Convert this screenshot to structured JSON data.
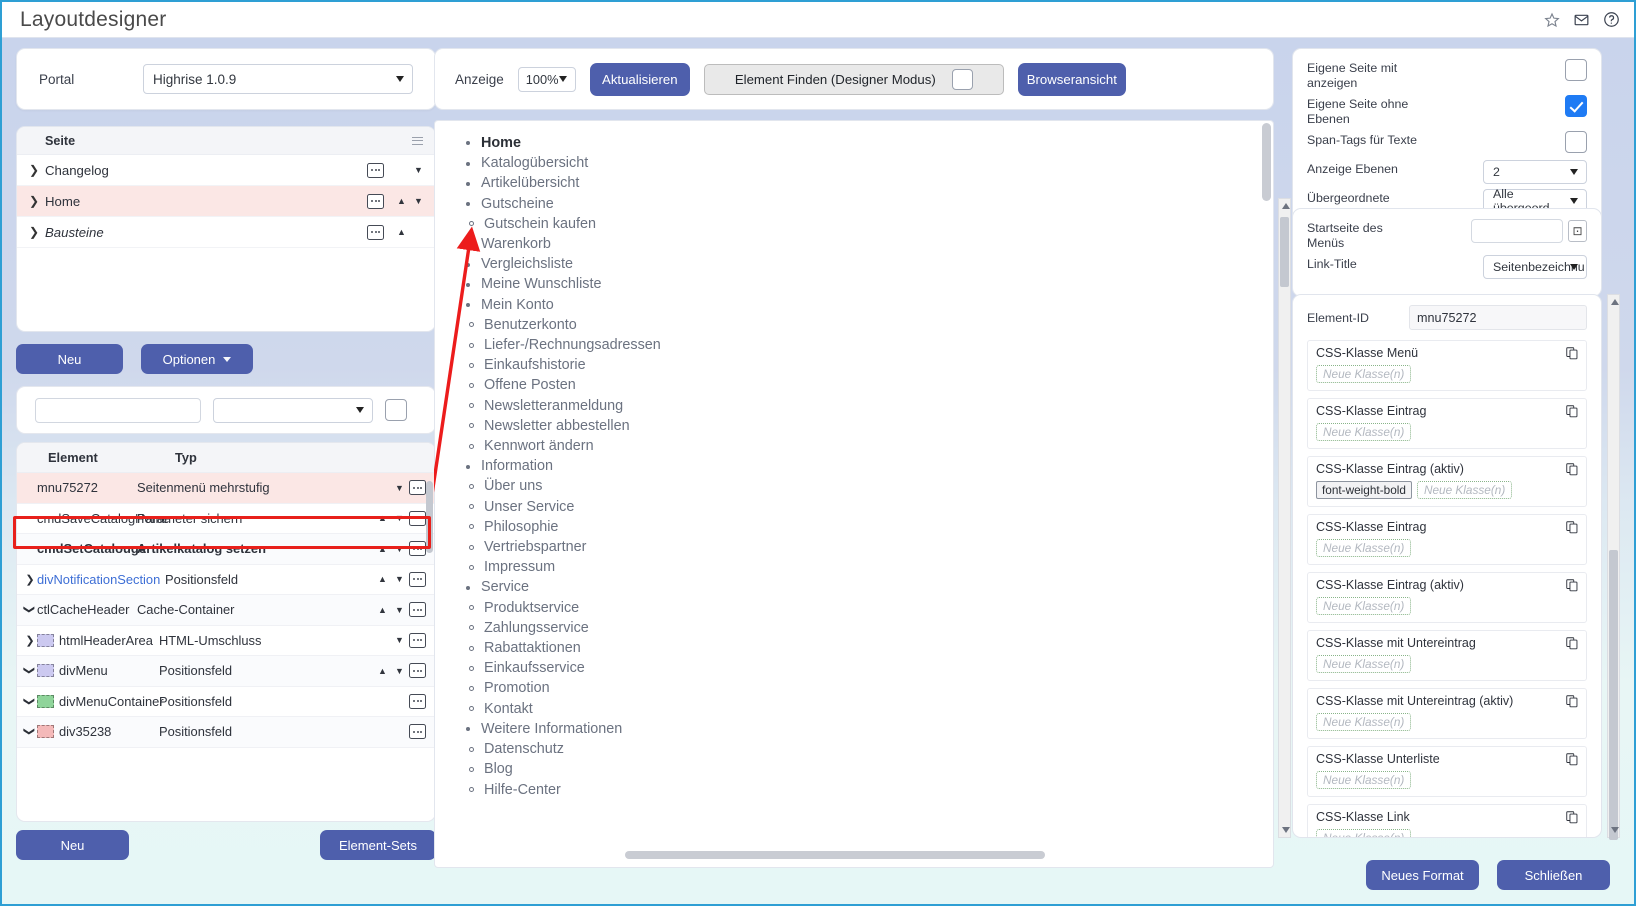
{
  "window": {
    "title": "Layoutdesigner",
    "header_icons": [
      "star-icon",
      "mail-icon",
      "help-icon"
    ]
  },
  "colors": {
    "accent": "#4e5fac",
    "selection_row": "#fbe7e5",
    "highlight_outline": "#e8201b",
    "checkbox_on": "#1f7bf4",
    "window_border": "#2e9fd4"
  },
  "left": {
    "portal_label": "Portal",
    "portal_value": "Highrise 1.0.9",
    "page_table": {
      "header": "Seite",
      "rows": [
        {
          "name": "Changelog",
          "italic": false,
          "selected": false,
          "up": false,
          "down": true
        },
        {
          "name": "Home",
          "italic": false,
          "selected": true,
          "up": true,
          "down": true
        },
        {
          "name": "Bausteine",
          "italic": true,
          "selected": false,
          "up": true,
          "down": false
        }
      ]
    },
    "buttons_top": {
      "new": "Neu",
      "options": "Optionen"
    },
    "filter": {
      "text_value": "",
      "select_value": ""
    },
    "element_table": {
      "columns": [
        "Element",
        "Typ"
      ],
      "rows": [
        {
          "name": "mnu75272",
          "type": "Seitenmenü mehrstufig",
          "selected": true,
          "bold": false,
          "link": false,
          "twisty": "",
          "swatch": "",
          "up": false,
          "down": true
        },
        {
          "name": "cmdSaveCatalogHome",
          "type": "Parameter sichern",
          "selected": false,
          "bold": false,
          "link": false,
          "twisty": "",
          "swatch": "",
          "up": true,
          "down": true
        },
        {
          "name": "cmdSetCatalouge",
          "type": "Artikelkatalog setzen",
          "selected": false,
          "bold": true,
          "link": false,
          "twisty": "",
          "swatch": "",
          "up": true,
          "down": true
        },
        {
          "name": "divNotificationSection",
          "type": "Positionsfeld",
          "selected": false,
          "bold": false,
          "link": true,
          "twisty": "right",
          "swatch": "",
          "up": true,
          "down": true
        },
        {
          "name": "ctlCacheHeader",
          "type": "Cache-Container",
          "selected": false,
          "bold": false,
          "link": false,
          "twisty": "down",
          "swatch": "",
          "up": true,
          "down": true
        },
        {
          "name": "htmlHeaderArea",
          "type": "HTML-Umschluss",
          "selected": false,
          "bold": false,
          "link": false,
          "twisty": "right",
          "swatch": "#ccc9f0",
          "up": false,
          "down": true
        },
        {
          "name": "divMenu",
          "type": "Positionsfeld",
          "selected": false,
          "bold": false,
          "link": false,
          "twisty": "down",
          "swatch": "#ccc9f0",
          "up": true,
          "down": true
        },
        {
          "name": "divMenuContainer",
          "type": "Positionsfeld",
          "selected": false,
          "bold": false,
          "link": false,
          "twisty": "down",
          "swatch": "#8fd49a",
          "up": false,
          "down": false
        },
        {
          "name": "div35238",
          "type": "Positionsfeld",
          "selected": false,
          "bold": false,
          "link": false,
          "twisty": "down",
          "swatch": "#f4b9b9",
          "up": false,
          "down": false
        }
      ]
    },
    "buttons_bottom": {
      "new": "Neu",
      "element_sets": "Element-Sets"
    }
  },
  "center": {
    "toolbar": {
      "anzeige_label": "Anzeige",
      "zoom_value": "100%",
      "refresh_label": "Aktualisieren",
      "find_label": "Element Finden (Designer Modus)",
      "find_checked": false,
      "browser_label": "Browseransicht"
    },
    "menu_preview": [
      {
        "label": "Home",
        "bold": true,
        "children": []
      },
      {
        "label": "Katalogübersicht",
        "bold": false,
        "children": []
      },
      {
        "label": "Artikelübersicht",
        "bold": false,
        "children": []
      },
      {
        "label": "Gutscheine",
        "bold": false,
        "children": [
          "Gutschein kaufen"
        ]
      },
      {
        "label": "Warenkorb",
        "bold": false,
        "children": []
      },
      {
        "label": "Vergleichsliste",
        "bold": false,
        "children": []
      },
      {
        "label": "Meine Wunschliste",
        "bold": false,
        "children": []
      },
      {
        "label": "Mein Konto",
        "bold": false,
        "children": [
          "Benutzerkonto",
          "Liefer-/Rechnungsadressen",
          "Einkaufshistorie",
          "Offene Posten",
          "Newsletteranmeldung",
          "Newsletter abbestellen",
          "Kennwort ändern"
        ]
      },
      {
        "label": "Information",
        "bold": false,
        "children": [
          "Über uns",
          "Unser Service",
          "Philosophie",
          "Vertriebspartner",
          "Impressum"
        ]
      },
      {
        "label": "Service",
        "bold": false,
        "children": [
          "Produktservice",
          "Zahlungsservice",
          "Rabattaktionen",
          "Einkaufsservice",
          "Promotion",
          "Kontakt"
        ]
      },
      {
        "label": "Weitere Informationen",
        "bold": false,
        "children": [
          "Datenschutz",
          "Blog",
          "Hilfe-Center"
        ]
      }
    ]
  },
  "right": {
    "options": [
      {
        "label": "Eigene Seite mit anzeigen",
        "checked": false
      },
      {
        "label": "Eigene Seite ohne Ebenen",
        "checked": true
      },
      {
        "label": "Span-Tags für Texte",
        "checked": false
      }
    ],
    "ebenen_label": "Anzeige Ebenen",
    "ebenen_value": "2",
    "uebergeordnet_label": "Übergeordnete Seite(n) als aktiv anzeigen",
    "uebergeordnet_value": "Alle übergeord",
    "startseite_label": "Startseite des Menüs",
    "startseite_value": "",
    "linktitle_label": "Link-Title",
    "linktitle_value": "Seitenbezeichnu",
    "element_id_label": "Element-ID",
    "element_id_value": "mnu75272",
    "css_blocks": [
      {
        "title": "CSS-Klasse Menü",
        "values": [],
        "placeholder": "Neue Klasse(n)"
      },
      {
        "title": "CSS-Klasse Eintrag",
        "values": [],
        "placeholder": "Neue Klasse(n)"
      },
      {
        "title": "CSS-Klasse Eintrag (aktiv)",
        "values": [
          "font-weight-bold"
        ],
        "placeholder": "Neue Klasse(n)"
      },
      {
        "title": "CSS-Klasse Eintrag",
        "values": [],
        "placeholder": "Neue Klasse(n)"
      },
      {
        "title": "CSS-Klasse Eintrag (aktiv)",
        "values": [],
        "placeholder": "Neue Klasse(n)"
      },
      {
        "title": "CSS-Klasse mit Untereintrag",
        "values": [],
        "placeholder": "Neue Klasse(n)"
      },
      {
        "title": "CSS-Klasse mit Untereintrag (aktiv)",
        "values": [],
        "placeholder": "Neue Klasse(n)"
      },
      {
        "title": "CSS-Klasse Unterliste",
        "values": [],
        "placeholder": "Neue Klasse(n)"
      },
      {
        "title": "CSS-Klasse Link",
        "values": [],
        "placeholder": "Neue Klasse(n)"
      }
    ],
    "buttons": {
      "new_format": "Neues Format",
      "close": "Schließen"
    }
  }
}
